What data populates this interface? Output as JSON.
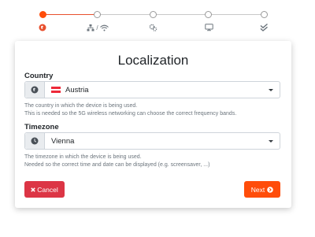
{
  "wizard": {
    "steps": [
      {
        "icon": "globe-icon",
        "active": true
      },
      {
        "icon": "network-wifi-icon",
        "active": false
      },
      {
        "icon": "settings-icon",
        "active": false
      },
      {
        "icon": "monitor-icon",
        "active": false
      },
      {
        "icon": "check-icon",
        "active": false
      }
    ],
    "network_step_separator": "/"
  },
  "card": {
    "title": "Localization",
    "country": {
      "label": "Country",
      "value": "Austria",
      "flag_colors": [
        "#ed2939",
        "#ffffff",
        "#ed2939"
      ],
      "help_line_1": "The country in which the device is being used.",
      "help_line_2": "This is needed so the 5G wireless networking can choose the correct frequency bands."
    },
    "timezone": {
      "label": "Timezone",
      "value": "Vienna",
      "help_line_1": "The timezone in which the device is being used.",
      "help_line_2": "Needed so the correct time and date can be displayed (e.g. screensaver, ...)"
    },
    "buttons": {
      "cancel_label": "Cancel",
      "next_label": "Next"
    }
  },
  "colors": {
    "accent": "#ff4d0a",
    "cancel": "#dc3545"
  }
}
